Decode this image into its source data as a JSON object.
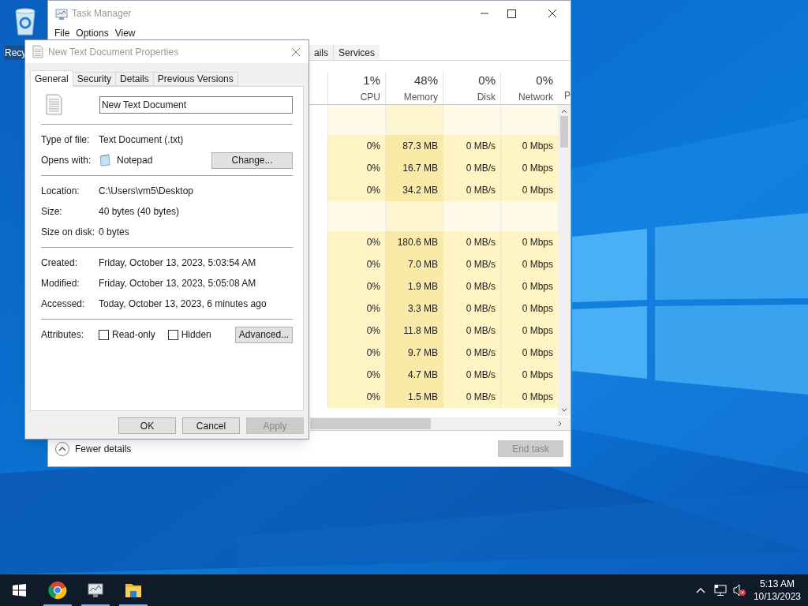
{
  "desktop": {
    "icons": [
      {
        "label": "Recy"
      }
    ]
  },
  "task_manager": {
    "title": "Task Manager",
    "menu": [
      "File",
      "Options",
      "View"
    ],
    "tabs": [
      {
        "label": "ails",
        "selected": false
      },
      {
        "label": "Services",
        "selected": false
      }
    ],
    "columns": [
      {
        "percent": "1%",
        "label": "CPU"
      },
      {
        "percent": "48%",
        "label": "Memory"
      },
      {
        "percent": "0%",
        "label": "Disk"
      },
      {
        "percent": "0%",
        "label": "Network"
      },
      {
        "label": "P"
      }
    ],
    "rows": [
      {
        "kind": "group"
      },
      {
        "kind": "process",
        "cpu": "0%",
        "memory": "87.3 MB",
        "disk": "0 MB/s",
        "network": "0 Mbps"
      },
      {
        "kind": "process",
        "cpu": "0%",
        "memory": "16.7 MB",
        "disk": "0 MB/s",
        "network": "0 Mbps"
      },
      {
        "kind": "process",
        "cpu": "0%",
        "memory": "34.2 MB",
        "disk": "0 MB/s",
        "network": "0 Mbps"
      },
      {
        "kind": "group"
      },
      {
        "kind": "process",
        "cpu": "0%",
        "memory": "180.6 MB",
        "disk": "0 MB/s",
        "network": "0 Mbps"
      },
      {
        "kind": "process",
        "cpu": "0%",
        "memory": "7.0 MB",
        "disk": "0 MB/s",
        "network": "0 Mbps"
      },
      {
        "kind": "process",
        "cpu": "0%",
        "memory": "1.9 MB",
        "disk": "0 MB/s",
        "network": "0 Mbps"
      },
      {
        "kind": "process",
        "cpu": "0%",
        "memory": "3.3 MB",
        "disk": "0 MB/s",
        "network": "0 Mbps"
      },
      {
        "kind": "process",
        "cpu": "0%",
        "memory": "11.8 MB",
        "disk": "0 MB/s",
        "network": "0 Mbps"
      },
      {
        "kind": "process",
        "cpu": "0%",
        "memory": "9.7 MB",
        "disk": "0 MB/s",
        "network": "0 Mbps"
      },
      {
        "kind": "process",
        "cpu": "0%",
        "memory": "4.7 MB",
        "disk": "0 MB/s",
        "network": "0 Mbps"
      },
      {
        "kind": "process",
        "cpu": "0%",
        "memory": "1.5 MB",
        "disk": "0 MB/s",
        "network": "0 Mbps"
      }
    ],
    "fewer_details": "Fewer details",
    "end_task": {
      "label": "End task",
      "disabled": true
    }
  },
  "properties": {
    "title": "New Text Document Properties",
    "tabs": [
      {
        "label": "General",
        "selected": true
      },
      {
        "label": "Security",
        "selected": false
      },
      {
        "label": "Details",
        "selected": false
      },
      {
        "label": "Previous Versions",
        "selected": false
      }
    ],
    "file_name": "New Text Document",
    "sections": [
      [
        {
          "label": "Type of file:",
          "value": "Text Document (.txt)"
        },
        {
          "label": "Opens with:",
          "value": "Notepad",
          "kind": "app",
          "button": "Change..."
        }
      ],
      [
        {
          "label": "Location:",
          "value": "C:\\Users\\vm5\\Desktop"
        },
        {
          "label": "Size:",
          "value": "40 bytes (40 bytes)"
        },
        {
          "label": "Size on disk:",
          "value": "0 bytes"
        }
      ],
      [
        {
          "label": "Created:",
          "value": "Friday, October 13, 2023, 5:03:54 AM"
        },
        {
          "label": "Modified:",
          "value": "Friday, October 13, 2023, 5:05:08 AM"
        },
        {
          "label": "Accessed:",
          "value": "Today, October 13, 2023, 6 minutes ago"
        }
      ]
    ],
    "attributes": {
      "label": "Attributes:",
      "checkboxes": [
        {
          "label": "Read-only",
          "checked": false
        },
        {
          "label": "Hidden",
          "checked": false
        }
      ],
      "button": "Advanced..."
    },
    "buttons": [
      {
        "label": "OK",
        "disabled": false
      },
      {
        "label": "Cancel",
        "disabled": false
      },
      {
        "label": "Apply",
        "disabled": true
      }
    ]
  },
  "taskbar": {
    "apps": [
      {
        "kind": "chrome",
        "running": true
      },
      {
        "kind": "taskmgr",
        "running": true
      },
      {
        "kind": "explorer",
        "running": true
      }
    ],
    "clock": {
      "time": "5:13 AM",
      "date": "10/13/2023"
    }
  }
}
